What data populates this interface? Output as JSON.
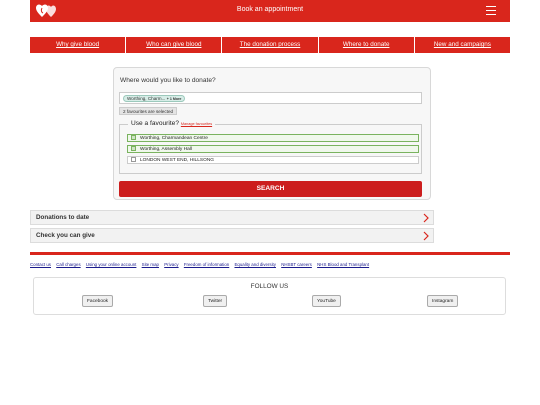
{
  "header": {
    "title": "Book an appointment",
    "menu_icon": "hamburger-menu-icon",
    "logo_icon": "blood-drop-hearts-logo",
    "brand_color": "#d9261c"
  },
  "nav": {
    "items": [
      {
        "label": "Why give blood"
      },
      {
        "label": "Who can give blood"
      },
      {
        "label": "The donation process"
      },
      {
        "label": "Where to donate"
      },
      {
        "label": "New and campaigns"
      }
    ]
  },
  "search": {
    "question": "Where would you like to donate?",
    "chip_label": "Worthing, Charm...",
    "chip_more": "+ 1 More",
    "fav_count": "2 favourites are selected",
    "fav_legend": "Use a favourite?",
    "fav_manage": "Manage favourites",
    "favourites": [
      {
        "label": "Worthing, Charmandean Centre",
        "checked": true
      },
      {
        "label": "Worthing, Assembly Hall",
        "checked": true
      },
      {
        "label": "LONDON WEST END, HILLSONG",
        "checked": false
      }
    ],
    "button_label": "SEARCH"
  },
  "accordions": [
    {
      "label": "Donations to date",
      "icon": "chevron-right-icon"
    },
    {
      "label": "Check you can give",
      "icon": "chevron-right-icon"
    }
  ],
  "footer": {
    "links": [
      "Contact us",
      "Call charges",
      "Using your online account",
      "Site map",
      "Privacy",
      "Freedom of information",
      "Equality and diversity",
      "NHSBT careers",
      "NHS Blood and Transplant"
    ],
    "follow_title": "FOLLOW US",
    "social": [
      "Facebook",
      "Twitter",
      "YouTube",
      "Instagram"
    ]
  }
}
